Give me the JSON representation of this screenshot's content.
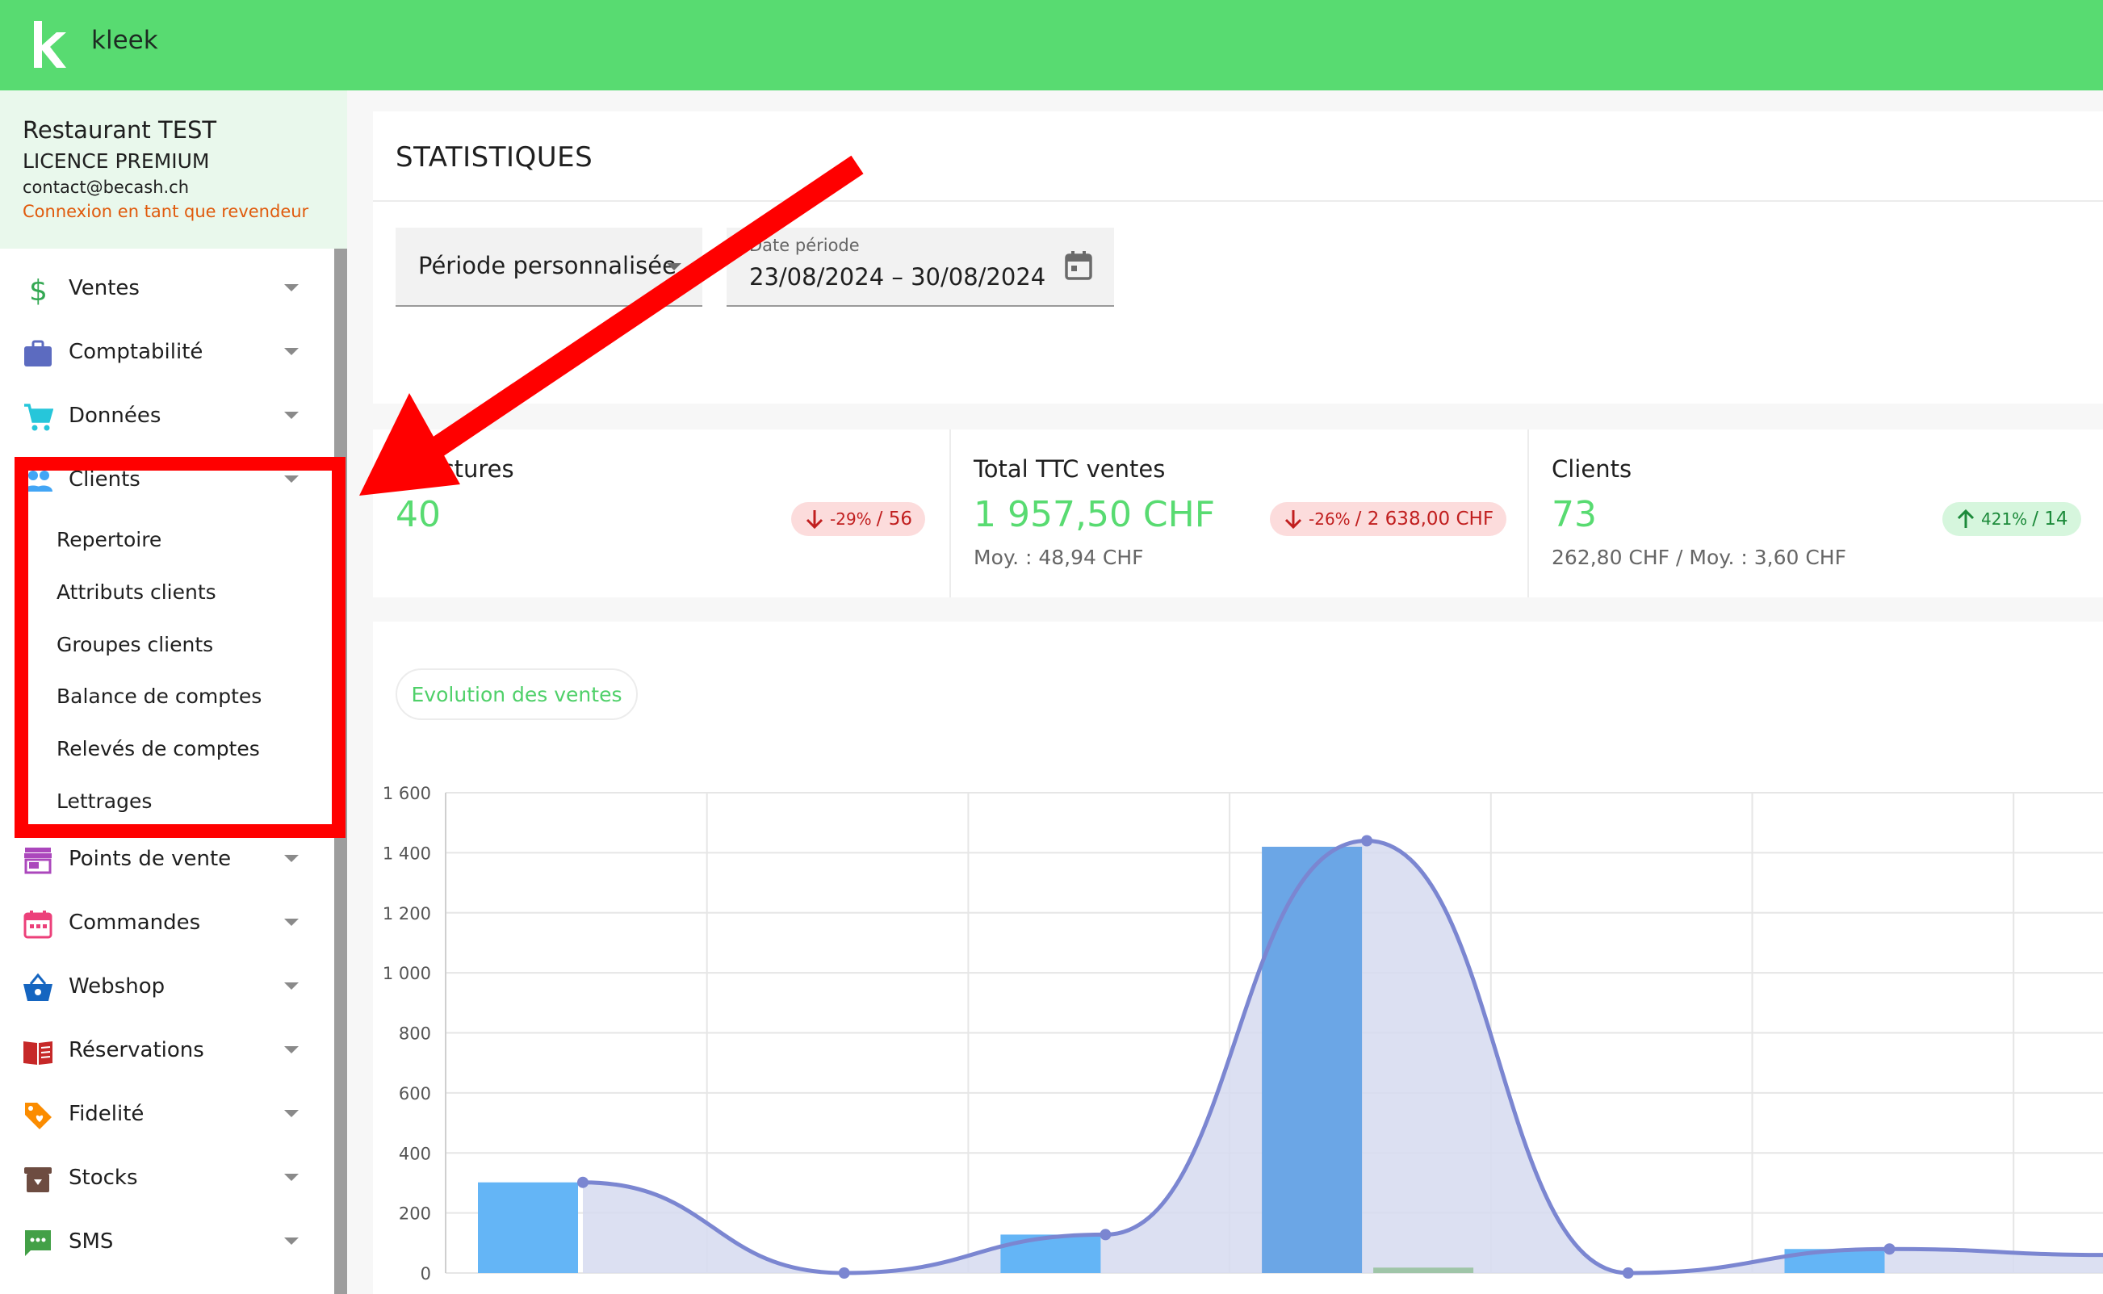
{
  "app": {
    "brand": "kleek",
    "logo_letter": "k"
  },
  "account": {
    "name": "Restaurant TEST",
    "license": "LICENCE PREMIUM",
    "email": "contact@becash.ch",
    "reseller_notice": "Connexion en tant que revendeur"
  },
  "sidebar": {
    "items": [
      {
        "label": "Ventes",
        "icon": "dollar-icon",
        "color": "#34a853"
      },
      {
        "label": "Comptabilité",
        "icon": "briefcase-icon",
        "color": "#5c6bc0"
      },
      {
        "label": "Données",
        "icon": "cart-icon",
        "color": "#26c6da"
      },
      {
        "label": "Clients",
        "icon": "people-icon",
        "color": "#42a5f5"
      },
      {
        "label": "Points de vente",
        "icon": "store-icon",
        "color": "#ab47bc"
      },
      {
        "label": "Commandes",
        "icon": "calendar-icon",
        "color": "#ec407a"
      },
      {
        "label": "Webshop",
        "icon": "basket-icon",
        "color": "#1565c0"
      },
      {
        "label": "Réservations",
        "icon": "book-icon",
        "color": "#c62828"
      },
      {
        "label": "Fidelité",
        "icon": "tag-icon",
        "color": "#fb8c00"
      },
      {
        "label": "Stocks",
        "icon": "archive-icon",
        "color": "#6d4c41"
      },
      {
        "label": "SMS",
        "icon": "sms-icon",
        "color": "#43a047"
      }
    ],
    "clients_submenu": [
      "Repertoire",
      "Attributs clients",
      "Groupes clients",
      "Balance de comptes",
      "Relevés de comptes",
      "Lettrages"
    ]
  },
  "main": {
    "title": "STATISTIQUES",
    "period_select": "Période personnalisée",
    "date_caption": "Date période",
    "date_range": "23/08/2024 – 30/08/2024",
    "chip": "Evolution des ventes"
  },
  "kpis": [
    {
      "title": "s/Factures",
      "value": "40",
      "badge_pct": "-29%",
      "badge_ref": "/ 56",
      "trend": "down",
      "sub": ""
    },
    {
      "title": "Total TTC ventes",
      "value": "1 957,50 CHF",
      "badge_pct": "-26%",
      "badge_ref": "/ 2 638,00 CHF",
      "trend": "down",
      "sub": "Moy. : 48,94 CHF"
    },
    {
      "title": "Clients",
      "value": "73",
      "badge_pct": "421%",
      "badge_ref": "/ 14",
      "trend": "up",
      "sub": "262,80 CHF / Moy. : 3,60 CHF"
    }
  ],
  "colors": {
    "brand_green": "#58db71",
    "annotation_red": "#ff0000",
    "bar_blue": "#64b5f6",
    "bar_blue_dark": "#6ba6e6",
    "bar_green": "#9fc5a8",
    "line": "#7b86d1",
    "area": "#d6daf0"
  },
  "chart_data": {
    "type": "bar",
    "y_ticks": [
      "0",
      "200",
      "400",
      "600",
      "800",
      "1 000",
      "1 200",
      "1 400",
      "1 600"
    ],
    "ylim": [
      0,
      1600
    ],
    "categories_count": 6,
    "series": [
      {
        "values": [
          302,
          0,
          128,
          1420,
          0,
          80
        ]
      },
      {
        "values": [
          0,
          0,
          0,
          18,
          0,
          0
        ]
      }
    ],
    "line_values": [
      302,
      0,
      128,
      1440,
      0,
      80
    ],
    "grid": true
  }
}
